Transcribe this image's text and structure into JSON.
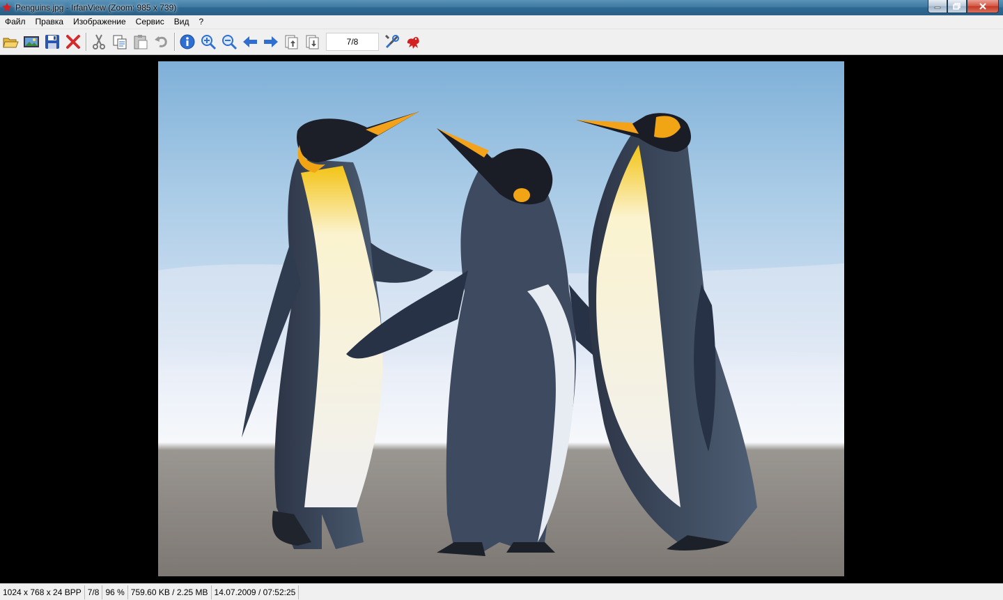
{
  "window": {
    "title": "Penguins.jpg - IrfanView (Zoom: 985 x 739)"
  },
  "menu": [
    "Файл",
    "Правка",
    "Изображение",
    "Сервис",
    "Вид",
    "?"
  ],
  "toolbar": {
    "page_indicator": "7/8",
    "icons": [
      "open-folder-icon",
      "slideshow-icon",
      "save-icon",
      "delete-icon",
      "cut-icon",
      "copy-icon",
      "paste-icon",
      "undo-icon",
      "info-icon",
      "zoom-in-icon",
      "zoom-out-icon",
      "previous-icon",
      "next-icon",
      "first-page-icon",
      "last-page-icon",
      "settings-tools-icon",
      "irfanview-logo-icon"
    ]
  },
  "status": {
    "dimensions": "1024 x 768 x 24 BPP",
    "index": "7/8",
    "zoom": "96 %",
    "size": "759.60 KB / 2.25 MB",
    "datetime": "14.07.2009 / 07:52:25"
  },
  "colors": {
    "viewer_background": "#000000",
    "title_bar": "#3f7aa3",
    "icon_blue": "#2e6fd1",
    "delete_red": "#d22b2b"
  }
}
